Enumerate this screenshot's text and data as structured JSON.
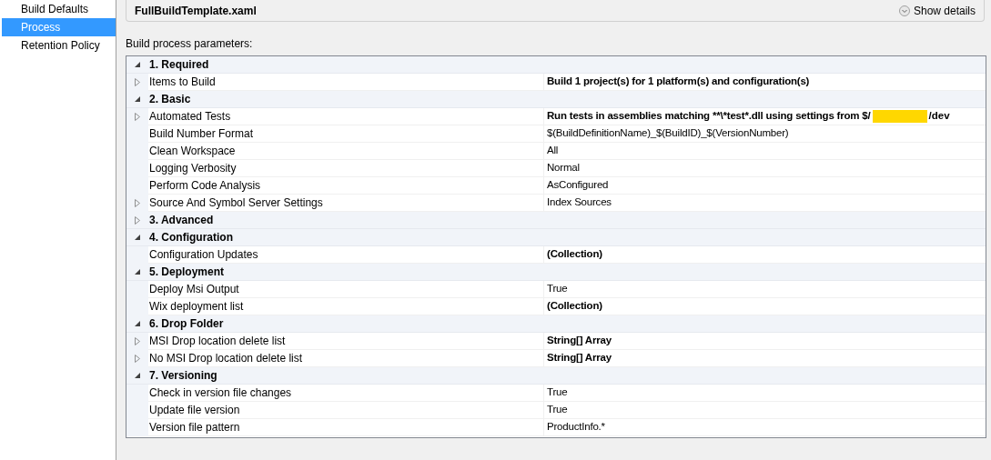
{
  "sidebar": {
    "items": [
      {
        "label": "Build Defaults",
        "selected": false
      },
      {
        "label": "Process",
        "selected": true
      },
      {
        "label": "Retention Policy",
        "selected": false
      }
    ]
  },
  "template": {
    "name": "FullBuildTemplate.xaml",
    "details_button": "Show details"
  },
  "parameters_label": "Build process parameters:",
  "categories": [
    {
      "title": "1. Required",
      "expanded": true,
      "items": [
        {
          "name": "Items to Build",
          "value": "Build 1 project(s) for 1 platform(s) and configuration(s)",
          "bold": true,
          "expandable": true
        }
      ]
    },
    {
      "title": "2. Basic",
      "expanded": true,
      "items": [
        {
          "name": "Automated Tests",
          "value": "Run tests in assemblies matching **\\*test*.dll using settings from $/",
          "redacted": true,
          "value_tail": "/dev",
          "bold": true,
          "expandable": true
        },
        {
          "name": "Build Number Format",
          "value": "$(BuildDefinitionName)_$(BuildID)_$(VersionNumber)",
          "bold": false,
          "expandable": false
        },
        {
          "name": "Clean Workspace",
          "value": "All",
          "bold": false,
          "expandable": false
        },
        {
          "name": "Logging Verbosity",
          "value": "Normal",
          "bold": false,
          "expandable": false
        },
        {
          "name": "Perform Code Analysis",
          "value": "AsConfigured",
          "bold": false,
          "expandable": false
        },
        {
          "name": "Source And Symbol Server Settings",
          "value": "Index Sources",
          "bold": false,
          "expandable": true
        }
      ]
    },
    {
      "title": "3. Advanced",
      "expanded": false
    },
    {
      "title": "4. Configuration",
      "expanded": true,
      "items": [
        {
          "name": "Configuration Updates",
          "value": "(Collection)",
          "bold": true,
          "expandable": false
        }
      ]
    },
    {
      "title": "5. Deployment",
      "expanded": true,
      "items": [
        {
          "name": "Deploy Msi Output",
          "value": "True",
          "bold": false,
          "expandable": false
        },
        {
          "name": "Wix deployment list",
          "value": "(Collection)",
          "bold": true,
          "expandable": false
        }
      ]
    },
    {
      "title": "6. Drop Folder",
      "expanded": true,
      "items": [
        {
          "name": "MSI Drop location delete list",
          "value": "String[] Array",
          "bold": true,
          "expandable": true
        },
        {
          "name": "No MSI Drop location delete list",
          "value": "String[] Array",
          "bold": true,
          "expandable": true
        }
      ]
    },
    {
      "title": "7. Versioning",
      "expanded": true,
      "items": [
        {
          "name": "Check in version file changes",
          "value": "True",
          "bold": false,
          "expandable": false
        },
        {
          "name": "Update file version",
          "value": "True",
          "bold": false,
          "expandable": false
        },
        {
          "name": "Version file pattern",
          "value": "ProductInfo.*",
          "bold": false,
          "expandable": false
        }
      ]
    }
  ]
}
